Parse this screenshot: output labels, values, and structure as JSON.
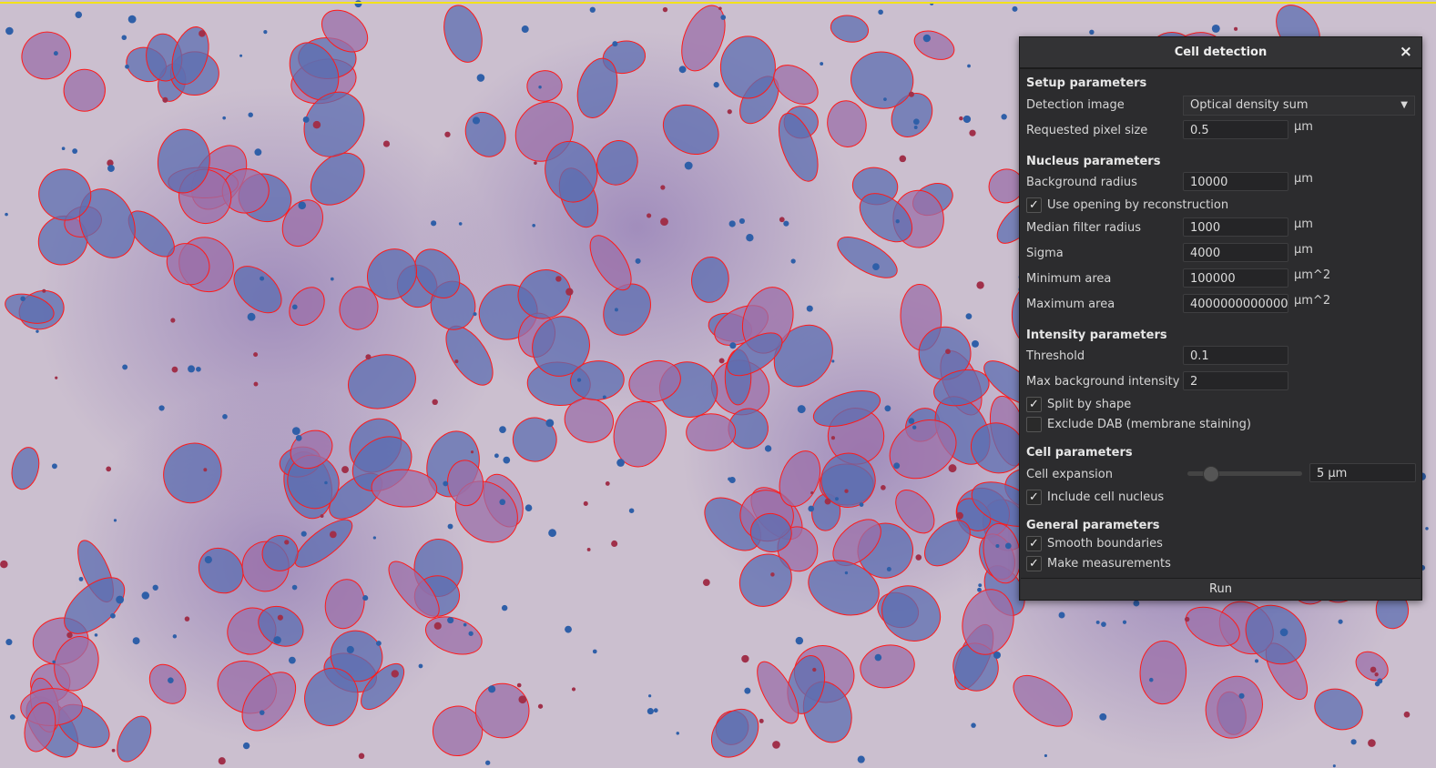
{
  "dialog": {
    "title": "Cell detection",
    "close_icon": "×",
    "setup": {
      "header": "Setup parameters",
      "detection_image_label": "Detection image",
      "detection_image_value": "Optical density sum",
      "pixel_size_label": "Requested pixel size",
      "pixel_size_value": "0.5",
      "pixel_size_unit": "µm"
    },
    "nucleus": {
      "header": "Nucleus parameters",
      "background_radius_label": "Background radius",
      "background_radius_value": "10000",
      "background_radius_unit": "µm",
      "opening_label": "Use opening by reconstruction",
      "opening_checked": true,
      "median_label": "Median filter radius",
      "median_value": "1000",
      "median_unit": "µm",
      "sigma_label": "Sigma",
      "sigma_value": "4000",
      "sigma_unit": "µm",
      "min_area_label": "Minimum area",
      "min_area_value": "100000",
      "min_area_unit": "µm^2",
      "max_area_label": "Maximum area",
      "max_area_value": "4000000000000",
      "max_area_unit": "µm^2"
    },
    "intensity": {
      "header": "Intensity parameters",
      "threshold_label": "Threshold",
      "threshold_value": "0.1",
      "max_bg_label": "Max background intensity",
      "max_bg_value": "2",
      "split_label": "Split by shape",
      "split_checked": true,
      "exclude_dab_label": "Exclude DAB (membrane staining)",
      "exclude_dab_checked": false
    },
    "cell": {
      "header": "Cell parameters",
      "expansion_label": "Cell expansion",
      "expansion_value": "5 µm",
      "expansion_slider_fraction": 0.15,
      "include_nucleus_label": "Include cell nucleus",
      "include_nucleus_checked": true
    },
    "general": {
      "header": "General parameters",
      "smooth_label": "Smooth boundaries",
      "smooth_checked": true,
      "measure_label": "Make measurements",
      "measure_checked": true
    },
    "run_label": "Run",
    "check_mark": "✓"
  },
  "colors": {
    "outline": "#ff1a1a",
    "roi_line": "#f2e21a"
  }
}
